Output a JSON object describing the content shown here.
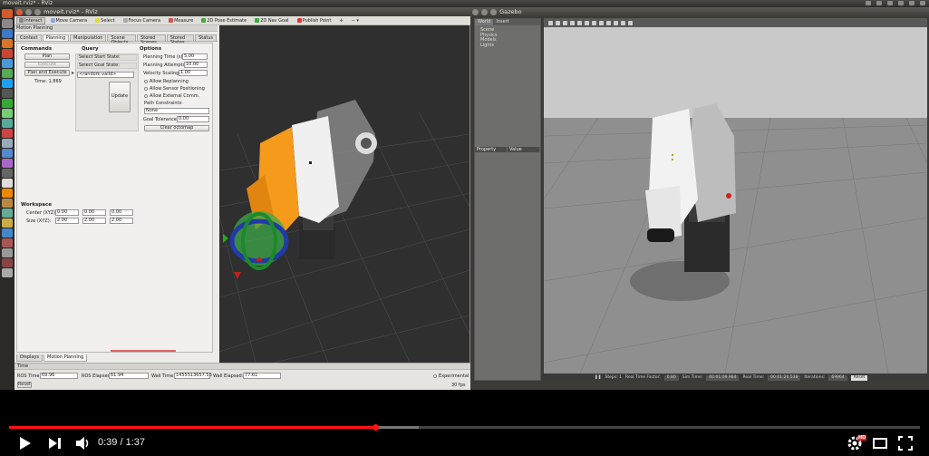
{
  "topbar": {
    "title": "moveit.rviz* - RViz"
  },
  "rviz": {
    "window_title": "moveit.rviz* - RViz",
    "toolbar": [
      "Interact",
      "Move Camera",
      "Select",
      "Focus Camera",
      "Measure",
      "2D Pose Estimate",
      "2D Nav Goal",
      "Publish Point"
    ],
    "panel_title": "Motion Planning",
    "tabs": [
      "Context",
      "Planning",
      "Manipulation",
      "Scene Objects",
      "Stored Scenes",
      "Stored States",
      "Status"
    ],
    "commands": {
      "heading": "Commands",
      "plan": "Plan",
      "execute": "Execute",
      "plan_execute": "Plan and Execute",
      "time": "Time: 1.869"
    },
    "query": {
      "heading": "Query",
      "start": "Select Start State:",
      "goal": "Select Goal State:",
      "goal_value": "<random valid>",
      "update": "Update"
    },
    "options": {
      "heading": "Options",
      "planning_time_label": "Planning Time (s):",
      "planning_time": "5.00",
      "attempts_label": "Planning Attempts:",
      "attempts": "10.00",
      "velocity_label": "Velocity Scaling:",
      "velocity": "1.00",
      "replanning": "Allow Replanning",
      "sensor": "Allow Sensor Positioning",
      "external": "Allow External Comm.",
      "path_constraints": "Path Constraints:",
      "path_value": "None",
      "goal_tol_label": "Goal Tolerance:",
      "goal_tol": "0.00",
      "clear_octomap": "Clear octomap"
    },
    "workspace": {
      "heading": "Workspace",
      "center_label": "Center (XYZ):",
      "center": [
        "0.00",
        "0.00",
        "0.00"
      ],
      "size_label": "Size (XYZ):",
      "size": [
        "2.00",
        "2.00",
        "2.00"
      ]
    },
    "bottom_tabs": [
      "Displays",
      "Motion Planning"
    ],
    "time_panel": {
      "title": "Time",
      "ros_time_label": "ROS Time:",
      "ros_time": "69.96",
      "ros_elapsed_label": "ROS Elapsed:",
      "ros_elapsed": "61.94",
      "wall_time_label": "Wall Time:",
      "wall_time": "1455513657.53",
      "wall_elapsed_label": "Wall Elapsed:",
      "wall_elapsed": "77.61",
      "experimental": "Experimental",
      "reset": "Reset",
      "fps": "30 fps"
    }
  },
  "gazebo": {
    "window_title": "Gazebo",
    "tabs": [
      "World",
      "Insert"
    ],
    "world_items": [
      "Scene",
      "Physics",
      "Models",
      "Lights"
    ],
    "prop_headers": [
      "Property",
      "Value"
    ],
    "status": {
      "steps": "Steps: 1",
      "real_time_factor_label": "Real Time Factor:",
      "real_time_factor": "0.80",
      "sim_time_label": "Sim Time:",
      "sim_time": "00:01:09.964",
      "real_time_label": "Real Time:",
      "real_time": "00:01:20.538",
      "iterations_label": "Iterations:",
      "iterations": "69964",
      "reset": "Reset"
    }
  },
  "player": {
    "time": "0:39 / 1:37",
    "played_fraction": 0.402,
    "loaded_fraction": 0.45,
    "hd_badge": "HD",
    "colors": {
      "accent": "#ff1111",
      "bg": "#000000"
    }
  }
}
